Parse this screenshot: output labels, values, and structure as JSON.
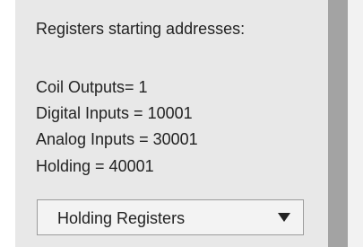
{
  "panel": {
    "heading": "Registers starting addresses:",
    "lines": [
      "Coil Outputs= 1",
      "Digital Inputs = 10001",
      "Analog Inputs = 30001",
      "Holding = 40001"
    ]
  },
  "register_select": {
    "selected": "Holding Registers",
    "arrow_icon": "triangle-down-icon"
  },
  "colors": {
    "panel_bg": "#e8e8e8",
    "divider": "#a3a3a3",
    "text": "#222222"
  }
}
